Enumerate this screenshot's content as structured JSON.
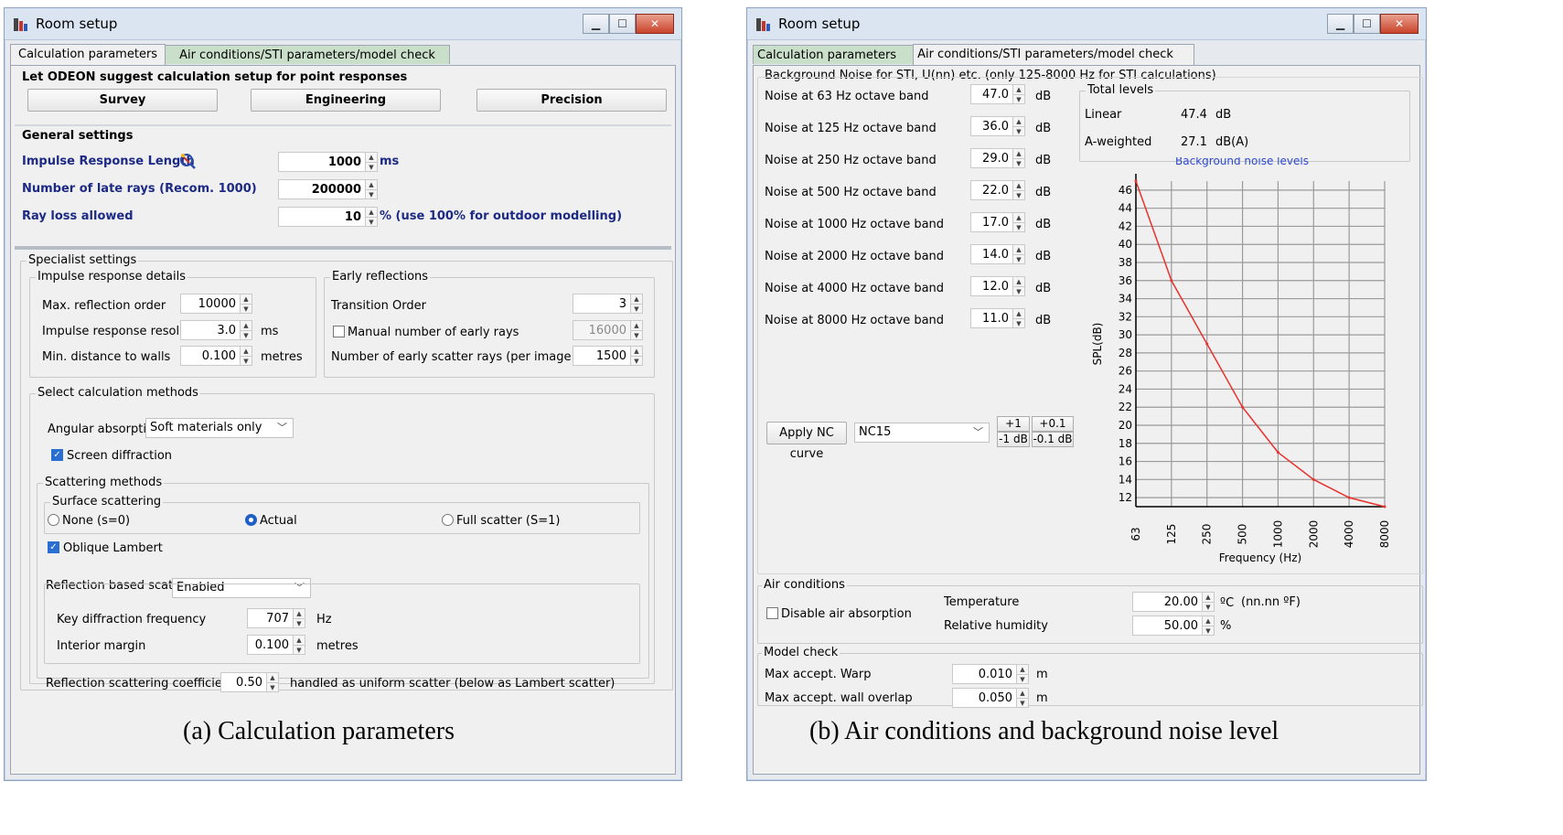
{
  "left": {
    "title": "Room setup",
    "tabs": [
      "Calculation parameters",
      "Air conditions/STI parameters/model check"
    ],
    "suggest": {
      "header": "Let ODEON suggest calculation setup for point responses",
      "buttons": [
        "Survey",
        "Engineering",
        "Precision"
      ]
    },
    "general": {
      "header": "General settings",
      "irl_label": "Impulse Response Length",
      "irl_value": "1000",
      "irl_unit": "ms",
      "late_label": "Number of late rays  (Recom. 1000)",
      "late_value": "200000",
      "loss_label": "Ray loss allowed",
      "loss_value": "10",
      "loss_unit": "% (use 100% for outdoor modelling)"
    },
    "specialist": {
      "header": "Specialist settings",
      "ird": {
        "title": "Impulse response details",
        "max_refl_label": "Max. reflection order",
        "max_refl_value": "10000",
        "res_label": "Impulse response resolution",
        "res_value": "3.0",
        "res_unit": "ms",
        "min_dist_label": "Min. distance to walls",
        "min_dist_value": "0.100",
        "min_dist_unit": "metres"
      },
      "early": {
        "title": "Early reflections",
        "trans_label": "Transition Order",
        "trans_value": "3",
        "manual_label": "Manual number of early  rays",
        "manual_value": "16000",
        "scatter_label": "Number of early scatter rays (per image source)",
        "scatter_value": "1500"
      },
      "methods": {
        "title": "Select calculation methods",
        "ang_label": "Angular absorption",
        "ang_value": "Soft materials only",
        "screen_label": "Screen diffraction",
        "scat_title": "Scattering methods",
        "surf_title": "Surface scattering",
        "radio_none": "None (s=0)",
        "radio_actual": "Actual",
        "radio_full": "Full scatter (S=1)",
        "oblique_label": "Oblique Lambert",
        "refl_label": "Reflection based scatter",
        "refl_value": "Enabled",
        "key_label": "Key diffraction frequency",
        "key_value": "707",
        "key_unit": "Hz",
        "margin_label": "Interior margin",
        "margin_value": "0.100",
        "margin_unit": "metres",
        "coef_label": "Reflection scattering coefficients >",
        "coef_value": "0.50",
        "coef_suffix": "handled as uniform scatter (below as Lambert scatter)"
      }
    }
  },
  "right": {
    "title": "Room setup",
    "tabs": [
      "Calculation parameters",
      "Air conditions/STI parameters/model check"
    ],
    "bg_title": "Background Noise for STI, U(nn) etc. (only 125-8000 Hz for STI calculations)",
    "noise": [
      {
        "label": "Noise at 63 Hz octave band",
        "value": "47.0",
        "unit": "dB"
      },
      {
        "label": "Noise at 125 Hz octave band",
        "value": "36.0",
        "unit": "dB"
      },
      {
        "label": "Noise at 250 Hz octave band",
        "value": "29.0",
        "unit": "dB"
      },
      {
        "label": "Noise at 500 Hz octave band",
        "value": "22.0",
        "unit": "dB"
      },
      {
        "label": "Noise at 1000 Hz octave band",
        "value": "17.0",
        "unit": "dB"
      },
      {
        "label": "Noise at 2000 Hz octave band",
        "value": "14.0",
        "unit": "dB"
      },
      {
        "label": "Noise at 4000 Hz octave band",
        "value": "12.0",
        "unit": "dB"
      },
      {
        "label": "Noise at 8000 Hz octave band",
        "value": "11.0",
        "unit": "dB"
      }
    ],
    "total": {
      "title": "Total levels",
      "linear_label": "Linear",
      "linear_value": "47.4",
      "linear_unit": "dB",
      "aw_label": "A-weighted",
      "aw_value": "27.1",
      "aw_unit": "dB(A)"
    },
    "nc": {
      "button": "Apply NC curve",
      "value": "NC15",
      "plus1": "+1 dB",
      "plus01": "+0.1 dB",
      "minus1": "-1 dB",
      "minus01": "-0.1 dB"
    },
    "air": {
      "title": "Air conditions",
      "disable_label": "Disable air absorption",
      "temp_label": "Temperature",
      "temp_value": "20.00",
      "temp_unit": "ºC",
      "temp_note": "(nn.nn ºF)",
      "hum_label": "Relative humidity",
      "hum_value": "50.00",
      "hum_unit": "%"
    },
    "model": {
      "title": "Model check",
      "warp_label": "Max accept. Warp",
      "warp_value": "0.010",
      "warp_unit": "m",
      "overlap_label": "Max accept. wall overlap",
      "overlap_value": "0.050",
      "overlap_unit": "m"
    }
  },
  "chart_data": {
    "type": "line",
    "title": "Background noise levels",
    "xlabel": "Frequency (Hz)",
    "ylabel": "SPL(dB)",
    "categories": [
      "63",
      "125",
      "250",
      "500",
      "1000",
      "2000",
      "4000",
      "8000"
    ],
    "values": [
      47,
      36,
      29,
      22,
      17,
      14,
      12,
      11
    ],
    "yticks": [
      "12",
      "14",
      "16",
      "18",
      "20",
      "22",
      "24",
      "26",
      "28",
      "30",
      "32",
      "34",
      "36",
      "38",
      "40",
      "42",
      "44",
      "46"
    ],
    "ylim": [
      11,
      47
    ],
    "grid": true,
    "line_color": "#e8322e",
    "title_color": "#2d4ad1"
  },
  "captions": {
    "a": "(a) Calculation parameters",
    "b": "(b) Air conditions and background noise level"
  }
}
